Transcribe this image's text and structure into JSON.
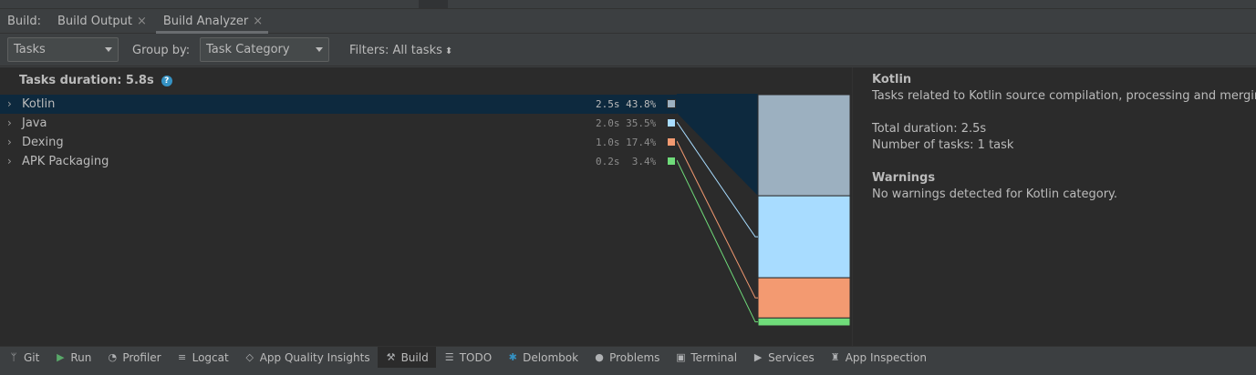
{
  "tabbar": {
    "prefix": "Build:",
    "tabs": [
      {
        "label": "Build Output",
        "active": false
      },
      {
        "label": "Build Analyzer",
        "active": true
      }
    ],
    "close_glyph": "×"
  },
  "toolbar": {
    "view_select": "Tasks",
    "group_by_label": "Group by:",
    "group_by_select": "Task Category",
    "filters_label": "Filters: All tasks"
  },
  "tasks": {
    "title": "Tasks duration: 5.8s",
    "help_glyph": "?",
    "rows": [
      {
        "name": "Kotlin",
        "duration": "2.5s",
        "percent": "43.8%",
        "color": "#9cb0c0",
        "fraction": 0.438
      },
      {
        "name": "Java",
        "duration": "2.0s",
        "percent": "35.5%",
        "color": "#a8dcff",
        "fraction": 0.355
      },
      {
        "name": "Dexing",
        "duration": "1.0s",
        "percent": "17.4%",
        "color": "#f39a71",
        "fraction": 0.174
      },
      {
        "name": "APK Packaging",
        "duration": "0.2s",
        "percent": "3.4%",
        "color": "#6fdc7a",
        "fraction": 0.034
      }
    ]
  },
  "details": {
    "title": "Kotlin",
    "description": "Tasks related to Kotlin source compilation, processing and merging.",
    "total_duration": "Total duration: 2.5s",
    "task_count": "Number of tasks: 1 task",
    "warnings_title": "Warnings",
    "warnings_text": "No warnings detected for Kotlin category."
  },
  "statusbar": {
    "items": [
      {
        "label": "Git",
        "icon": "git-branch-icon",
        "glyph": "ᛘ"
      },
      {
        "label": "Run",
        "icon": "run-icon",
        "glyph": "▶"
      },
      {
        "label": "Profiler",
        "icon": "profiler-icon",
        "glyph": "◔"
      },
      {
        "label": "Logcat",
        "icon": "logcat-icon",
        "glyph": "≡"
      },
      {
        "label": "App Quality Insights",
        "icon": "quality-icon",
        "glyph": "◇"
      },
      {
        "label": "Build",
        "icon": "hammer-icon",
        "glyph": "⚒",
        "active": true
      },
      {
        "label": "TODO",
        "icon": "todo-icon",
        "glyph": "☰"
      },
      {
        "label": "Delombok",
        "icon": "delombok-icon",
        "glyph": "✱"
      },
      {
        "label": "Problems",
        "icon": "problems-icon",
        "glyph": "●"
      },
      {
        "label": "Terminal",
        "icon": "terminal-icon",
        "glyph": "▣"
      },
      {
        "label": "Services",
        "icon": "services-icon",
        "glyph": "▶"
      },
      {
        "label": "App Inspection",
        "icon": "inspection-icon",
        "glyph": "♜"
      }
    ]
  },
  "colors": {
    "selected_row": "#0d293e",
    "panel": "#2b2b2b",
    "chrome": "#3c3f41"
  }
}
